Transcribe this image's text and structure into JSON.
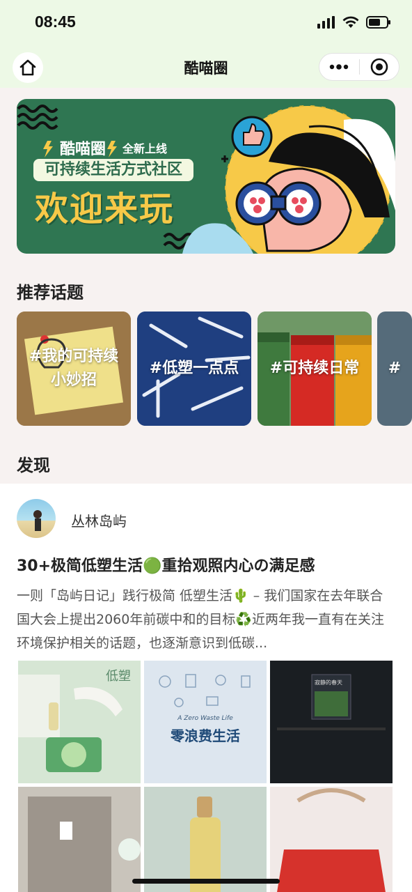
{
  "status_bar": {
    "time": "08:45",
    "icons": [
      "signal-icon",
      "wifi-icon",
      "battery-icon"
    ]
  },
  "nav": {
    "title": "酷喵圈",
    "home_icon": "home-icon",
    "more_icon": "more-dots-icon",
    "close_icon": "target-close-icon"
  },
  "banner": {
    "brand": "酷喵圈",
    "tag": "全新上线",
    "subtitle": "可持续生活方式社区",
    "headline": "欢迎来玩"
  },
  "sections": {
    "topics_title": "推荐话题",
    "discover_title": "发现"
  },
  "topics": [
    {
      "label": "#我的可持续小妙招",
      "line1": "#我的可持续",
      "line2": "小妙招"
    },
    {
      "label": "#低塑一点点"
    },
    {
      "label": "#可持续日常"
    },
    {
      "label": "#"
    }
  ],
  "post": {
    "author": "丛林岛屿",
    "title": "30+极简低塑生活🟢重拾观照内心の满足感",
    "body": "一则「岛屿日记」践行极简 低塑生活🌵 – 我们国家在去年联合国大会上提出2060年前碳中和的目标♻️近两年我一直有在关注环境保护相关的话题，也逐渐意识到低碳...",
    "images": [
      {
        "text": "低塑"
      },
      {
        "text": "零浪费生活",
        "sub": "A Zero Waste Life"
      },
      {
        "text": "寂静的春天"
      },
      {
        "text": ""
      },
      {
        "text": ""
      },
      {
        "text": ""
      }
    ]
  },
  "colors": {
    "header_bg": "#edf9e6",
    "page_bg": "#f7f2f1",
    "banner_green": "#2f7652",
    "banner_yellow": "#f7c948"
  }
}
